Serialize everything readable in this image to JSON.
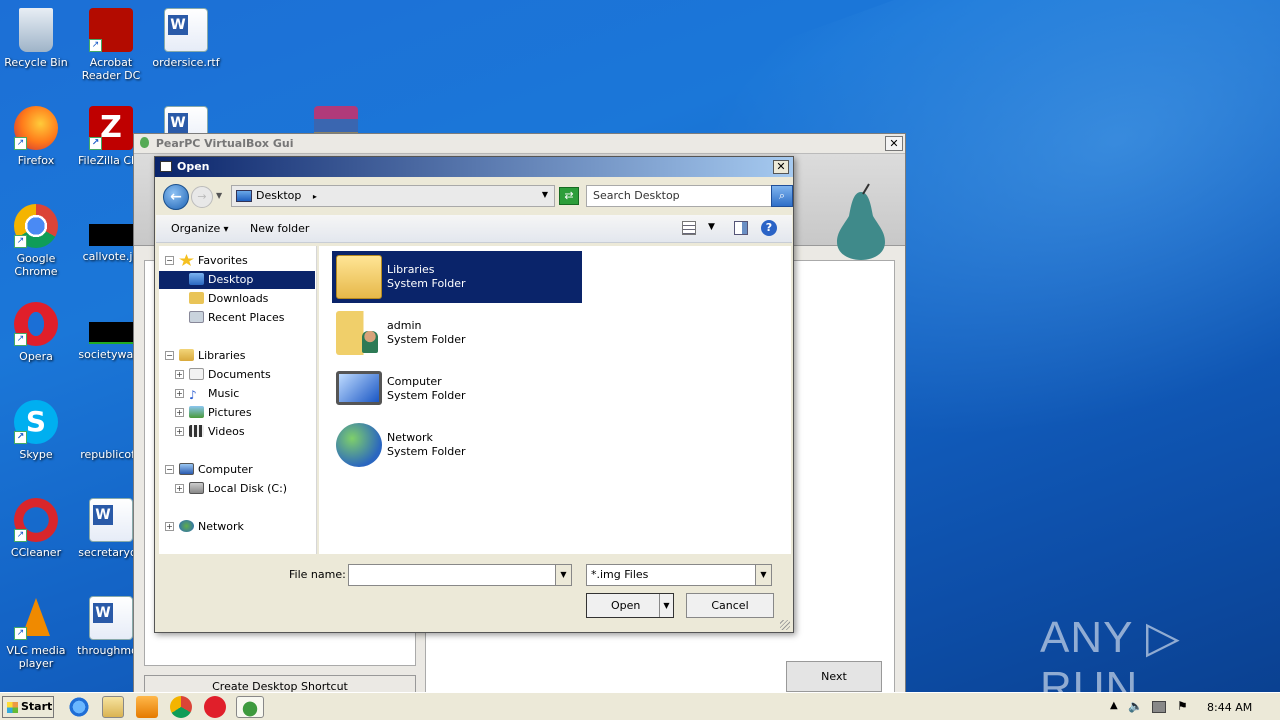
{
  "desktop": {
    "icons": [
      {
        "label": "Recycle Bin",
        "icon": "recycle-bin-icon"
      },
      {
        "label": "Acrobat Reader DC",
        "icon": "acrobat-icon"
      },
      {
        "label": "ordersice.rtf",
        "icon": "word-doc-icon"
      },
      {
        "label": "Firefox",
        "icon": "firefox-icon"
      },
      {
        "label": "FileZilla Clie",
        "icon": "filezilla-icon"
      },
      {
        "label": "Google Chrome",
        "icon": "chrome-icon"
      },
      {
        "label": "callvote.jp",
        "icon": "image-icon"
      },
      {
        "label": "Opera",
        "icon": "opera-icon"
      },
      {
        "label": "societywatc",
        "icon": "image-icon"
      },
      {
        "label": "Skype",
        "icon": "skype-icon"
      },
      {
        "label": "republicoffi",
        "icon": "doc-icon"
      },
      {
        "label": "CCleaner",
        "icon": "ccleaner-icon"
      },
      {
        "label": "secretaryde",
        "icon": "word-doc-icon"
      },
      {
        "label": "VLC media player",
        "icon": "vlc-icon"
      },
      {
        "label": "throughmon",
        "icon": "word-doc-icon"
      }
    ]
  },
  "pearpc": {
    "title": "PearPC VirtualBox Gui",
    "close_label": "✕",
    "shortcut_label": "Create Desktop Shortcut",
    "next_label": "Next"
  },
  "dialog": {
    "title": "Open",
    "close_label": "✕",
    "address": "Desktop",
    "search_placeholder": "Search Desktop",
    "organize_label": "Organize",
    "new_folder_label": "New folder",
    "help_label": "?",
    "tree": {
      "favorites": "Favorites",
      "desktop": "Desktop",
      "downloads": "Downloads",
      "recent_places": "Recent Places",
      "libraries": "Libraries",
      "documents": "Documents",
      "music": "Music",
      "pictures": "Pictures",
      "videos": "Videos",
      "computer": "Computer",
      "local_disk": "Local Disk (C:)",
      "network": "Network"
    },
    "files": [
      {
        "name": "Libraries",
        "type": "System Folder"
      },
      {
        "name": "admin",
        "type": "System Folder"
      },
      {
        "name": "Computer",
        "type": "System Folder"
      },
      {
        "name": "Network",
        "type": "System Folder"
      }
    ],
    "file_name_label": "File name:",
    "file_name_value": "",
    "file_type_value": "*.img Files",
    "open_label": "Open",
    "cancel_label": "Cancel"
  },
  "watermark": "ANY ▷ RUN",
  "taskbar": {
    "start_label": "Start",
    "clock": "8:44 AM"
  }
}
